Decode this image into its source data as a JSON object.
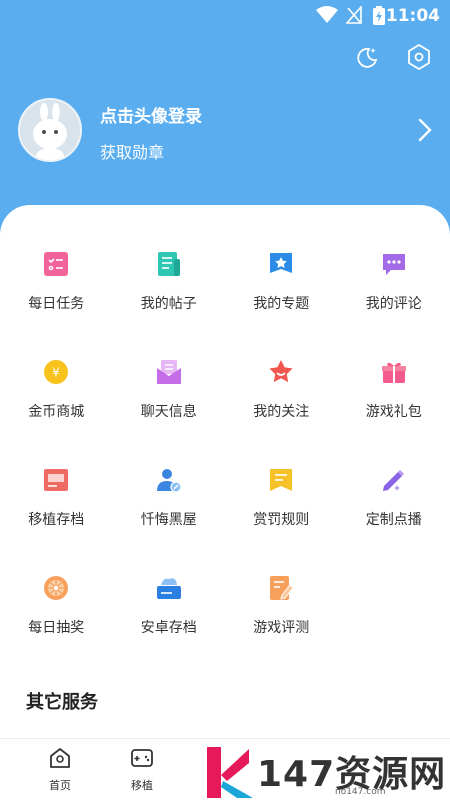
{
  "status": {
    "time": "11:04"
  },
  "header": {
    "icons": [
      "moon-stars-icon",
      "settings-hexagon-icon"
    ],
    "login_title": "点击头像登录",
    "login_subtitle": "获取勋章"
  },
  "menu": [
    {
      "label": "每日任务",
      "icon": "daily-task-icon"
    },
    {
      "label": "我的帖子",
      "icon": "my-posts-icon"
    },
    {
      "label": "我的专题",
      "icon": "my-topics-icon"
    },
    {
      "label": "我的评论",
      "icon": "my-comments-icon"
    },
    {
      "label": "金币商城",
      "icon": "coin-mall-icon"
    },
    {
      "label": "聊天信息",
      "icon": "chat-message-icon"
    },
    {
      "label": "我的关注",
      "icon": "my-follows-icon"
    },
    {
      "label": "游戏礼包",
      "icon": "game-gift-icon"
    },
    {
      "label": "移植存档",
      "icon": "port-save-icon"
    },
    {
      "label": "忏悔黑屋",
      "icon": "confession-room-icon"
    },
    {
      "label": "赏罚规则",
      "icon": "rules-icon"
    },
    {
      "label": "定制点播",
      "icon": "custom-request-icon"
    },
    {
      "label": "每日抽奖",
      "icon": "daily-lottery-icon"
    },
    {
      "label": "安卓存档",
      "icon": "android-save-icon"
    },
    {
      "label": "游戏评测",
      "icon": "game-review-icon"
    }
  ],
  "section_title": "其它服务",
  "tabs": [
    {
      "label": "首页",
      "icon": "home-icon"
    },
    {
      "label": "移植",
      "icon": "gamepad-icon"
    }
  ],
  "watermark": {
    "big": "147资源网",
    "small": "no147.com"
  },
  "colors": {
    "header_bg": "#5aaef0",
    "panel_bg": "#ffffff"
  }
}
